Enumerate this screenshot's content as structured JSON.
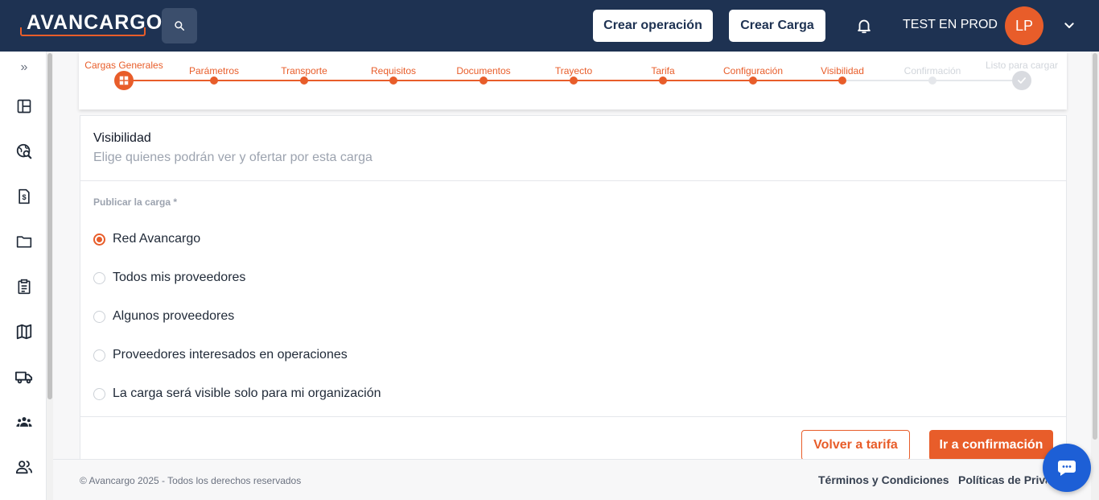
{
  "header": {
    "logo": "AVANCARGO",
    "search_icon": "search-icon",
    "create_operation": "Crear operación",
    "create_load": "Crear Carga",
    "bell_icon": "bell-icon",
    "user_name": "TEST EN PROD",
    "avatar_initials": "LP",
    "chevron_icon": "chevron-down-icon"
  },
  "sidebar": {
    "expand": "»",
    "items": [
      {
        "icon": "dashboard-icon"
      },
      {
        "icon": "globe-search-icon"
      },
      {
        "icon": "invoice-icon"
      },
      {
        "icon": "folder-icon"
      },
      {
        "icon": "clipboard-icon"
      },
      {
        "icon": "map-icon"
      },
      {
        "icon": "truck-icon"
      },
      {
        "icon": "group-icon"
      },
      {
        "icon": "users-icon"
      }
    ]
  },
  "stepper": {
    "steps": [
      {
        "label": "Cargas Generales",
        "state": "done"
      },
      {
        "label": "Parámetros",
        "state": "done"
      },
      {
        "label": "Transporte",
        "state": "done"
      },
      {
        "label": "Requisitos",
        "state": "done"
      },
      {
        "label": "Documentos",
        "state": "done"
      },
      {
        "label": "Trayecto",
        "state": "done"
      },
      {
        "label": "Tarifa",
        "state": "done"
      },
      {
        "label": "Configuración",
        "state": "done"
      },
      {
        "label": "Visibilidad",
        "state": "current"
      },
      {
        "label": "Confirmación",
        "state": "pending"
      },
      {
        "label": "Listo para cargar",
        "state": "pending"
      }
    ]
  },
  "visibility": {
    "title": "Visibilidad",
    "subtitle": "Elige quienes podrán ver y ofertar por esta carga",
    "field_label": "Publicar la carga *",
    "options": [
      {
        "label": "Red Avancargo",
        "selected": true
      },
      {
        "label": "Todos mis proveedores",
        "selected": false
      },
      {
        "label": "Algunos proveedores",
        "selected": false
      },
      {
        "label": "Proveedores interesados en operaciones",
        "selected": false
      },
      {
        "label": "La carga será visible solo para mi organización",
        "selected": false
      }
    ],
    "back_button": "Volver a tarifa",
    "next_button": "Ir a confirmación"
  },
  "footer": {
    "copyright": "© Avancargo 2025 - Todos los derechos reservados",
    "terms": "Términos y Condiciones",
    "privacy": "Políticas de Privacidad"
  },
  "colors": {
    "brand_navy": "#1e3252",
    "accent_orange": "#e85d2a",
    "chat_blue": "#1d5fd6"
  },
  "chat_icon": "chat-bubble-icon"
}
